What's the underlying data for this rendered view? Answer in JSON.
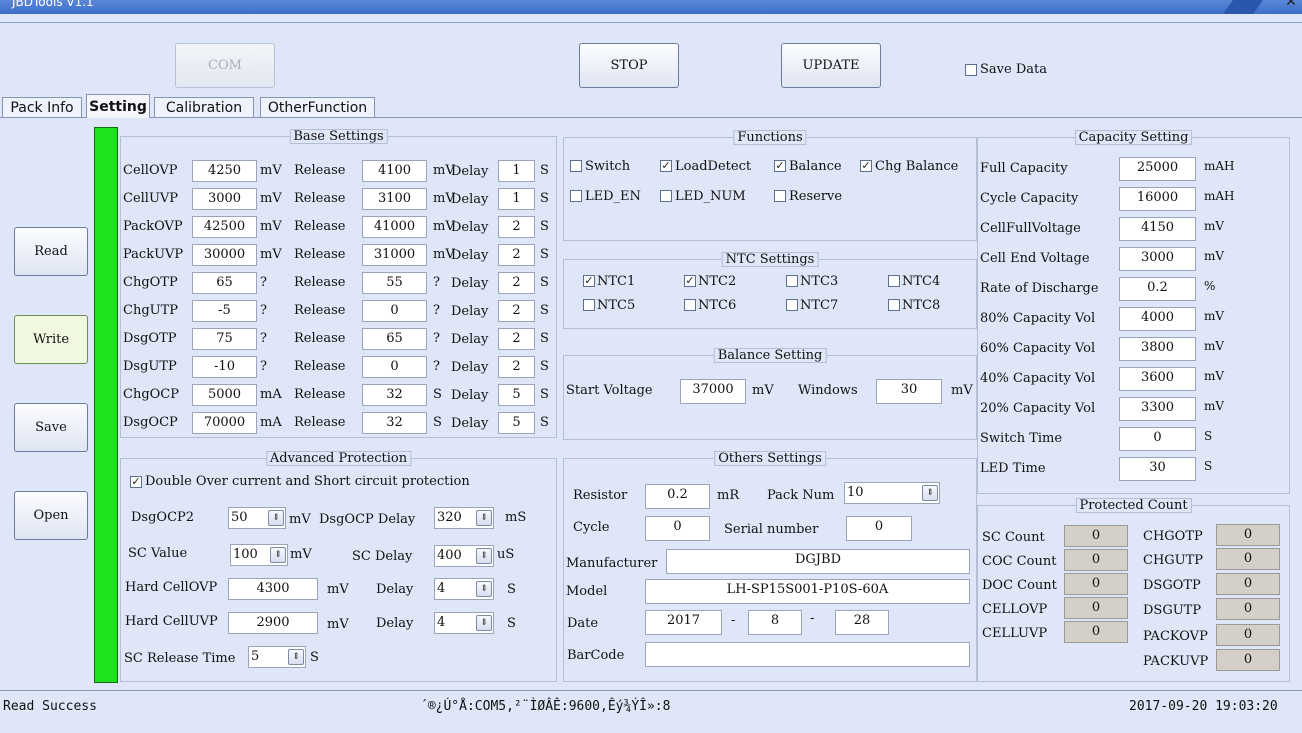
{
  "window": {
    "title": "JBDTools V1.1",
    "close": "✕"
  },
  "toolbar": {
    "com": "COM",
    "stop": "STOP",
    "update": "UPDATE",
    "save_data": "Save Data",
    "save_data_checked": false
  },
  "tabs": [
    {
      "label": "Pack Info",
      "active": false
    },
    {
      "label": "Setting",
      "active": true
    },
    {
      "label": "Calibration",
      "active": false
    },
    {
      "label": "OtherFunction",
      "active": false
    }
  ],
  "side_buttons": {
    "read": "Read",
    "write": "Write",
    "save": "Save",
    "open": "Open"
  },
  "base_settings": {
    "title": "Base Settings",
    "rows": [
      {
        "name": "CellOVP",
        "value": "4250",
        "unit": "mV",
        "rel_label": "Release",
        "release": "4100",
        "rel_unit": "mV",
        "delay_label": "Delay",
        "delay": "1",
        "delay_unit": "S"
      },
      {
        "name": "CellUVP",
        "value": "3000",
        "unit": "mV",
        "rel_label": "Release",
        "release": "3100",
        "rel_unit": "mV",
        "delay_label": "Delay",
        "delay": "1",
        "delay_unit": "S"
      },
      {
        "name": "PackOVP",
        "value": "42500",
        "unit": "mV",
        "rel_label": "Release",
        "release": "41000",
        "rel_unit": "mV",
        "delay_label": "Delay",
        "delay": "2",
        "delay_unit": "S"
      },
      {
        "name": "PackUVP",
        "value": "30000",
        "unit": "mV",
        "rel_label": "Release",
        "release": "31000",
        "rel_unit": "mV",
        "delay_label": "Delay",
        "delay": "2",
        "delay_unit": "S"
      },
      {
        "name": "ChgOTP",
        "value": "65",
        "unit": "?",
        "rel_label": "Release",
        "release": "55",
        "rel_unit": "?",
        "delay_label": "Delay",
        "delay": "2",
        "delay_unit": "S"
      },
      {
        "name": "ChgUTP",
        "value": "-5",
        "unit": "?",
        "rel_label": "Release",
        "release": "0",
        "rel_unit": "?",
        "delay_label": "Delay",
        "delay": "2",
        "delay_unit": "S"
      },
      {
        "name": "DsgOTP",
        "value": "75",
        "unit": "?",
        "rel_label": "Release",
        "release": "65",
        "rel_unit": "?",
        "delay_label": "Delay",
        "delay": "2",
        "delay_unit": "S"
      },
      {
        "name": "DsgUTP",
        "value": "-10",
        "unit": "?",
        "rel_label": "Release",
        "release": "0",
        "rel_unit": "?",
        "delay_label": "Delay",
        "delay": "2",
        "delay_unit": "S"
      },
      {
        "name": "ChgOCP",
        "value": "5000",
        "unit": "mA",
        "rel_label": "Release",
        "release": "32",
        "rel_unit": "S",
        "delay_label": "Delay",
        "delay": "5",
        "delay_unit": "S"
      },
      {
        "name": "DsgOCP",
        "value": "70000",
        "unit": "mA",
        "rel_label": "Release",
        "release": "32",
        "rel_unit": "S",
        "delay_label": "Delay",
        "delay": "5",
        "delay_unit": "S"
      }
    ]
  },
  "advanced": {
    "title": "Advanced Protection",
    "double_label": "Double Over current and Short circuit protection",
    "double_checked": true,
    "dsgocp2_label": "DsgOCP2",
    "dsgocp2_value": "50",
    "dsgocp2_unit": "mV",
    "dsgocp_delay_label": "DsgOCP Delay",
    "dsgocp_delay_value": "320",
    "dsgocp_delay_unit": "mS",
    "sc_value_label": "SC Value",
    "sc_value": "100",
    "sc_value_unit": "mV",
    "sc_delay_label": "SC Delay",
    "sc_delay_value": "400",
    "sc_delay_unit": "uS",
    "hard_ovp_label": "Hard CellOVP",
    "hard_ovp_value": "4300",
    "hard_ovp_unit": "mV",
    "hard_ovp_delay_label": "Delay",
    "hard_ovp_delay_value": "4",
    "hard_ovp_delay_unit": "S",
    "hard_uvp_label": "Hard CellUVP",
    "hard_uvp_value": "2900",
    "hard_uvp_unit": "mV",
    "hard_uvp_delay_label": "Delay",
    "hard_uvp_delay_value": "4",
    "hard_uvp_delay_unit": "S",
    "sc_release_label": "SC Release Time",
    "sc_release_value": "5",
    "sc_release_unit": "S"
  },
  "functions": {
    "title": "Functions",
    "items": [
      {
        "label": "Switch",
        "checked": false
      },
      {
        "label": "LoadDetect",
        "checked": true
      },
      {
        "label": "Balance",
        "checked": true
      },
      {
        "label": "Chg Balance",
        "checked": true
      },
      {
        "label": "LED_EN",
        "checked": false
      },
      {
        "label": "LED_NUM",
        "checked": false
      },
      {
        "label": "Reserve",
        "checked": false
      }
    ]
  },
  "ntc": {
    "title": "NTC Settings",
    "items": [
      {
        "label": "NTC1",
        "checked": true
      },
      {
        "label": "NTC2",
        "checked": true
      },
      {
        "label": "NTC3",
        "checked": false
      },
      {
        "label": "NTC4",
        "checked": false
      },
      {
        "label": "NTC5",
        "checked": false
      },
      {
        "label": "NTC6",
        "checked": false
      },
      {
        "label": "NTC7",
        "checked": false
      },
      {
        "label": "NTC8",
        "checked": false
      }
    ]
  },
  "balance": {
    "title": "Balance Setting",
    "start_label": "Start Voltage",
    "start_value": "37000",
    "start_unit": "mV",
    "windows_label": "Windows",
    "windows_value": "30",
    "windows_unit": "mV"
  },
  "others": {
    "title": "Others Settings",
    "resistor_label": "Resistor",
    "resistor_value": "0.2",
    "resistor_unit": "mR",
    "pack_num_label": "Pack Num",
    "pack_num_value": "10",
    "cycle_label": "Cycle",
    "cycle_value": "0",
    "serial_label": "Serial number",
    "serial_value": "0",
    "manufacturer_label": "Manufacturer",
    "manufacturer_value": "DGJBD",
    "model_label": "Model",
    "model_value": "LH-SP15S001-P10S-60A",
    "date_label": "Date",
    "date_year": "2017",
    "date_sep": "-",
    "date_month": "8",
    "date_day": "28",
    "barcode_label": "BarCode",
    "barcode_value": ""
  },
  "capacity": {
    "title": "Capacity Setting",
    "rows": [
      {
        "label": "Full Capacity",
        "value": "25000",
        "unit": "mAH"
      },
      {
        "label": "Cycle Capacity",
        "value": "16000",
        "unit": "mAH"
      },
      {
        "label": "CellFullVoltage",
        "value": "4150",
        "unit": "mV"
      },
      {
        "label": "Cell End Voltage",
        "value": "3000",
        "unit": "mV"
      },
      {
        "label": "Rate of Discharge",
        "value": "0.2",
        "unit": "%"
      },
      {
        "label": "80% Capacity Vol",
        "value": "4000",
        "unit": "mV"
      },
      {
        "label": "60% Capacity Vol",
        "value": "3800",
        "unit": "mV"
      },
      {
        "label": "40% Capacity Vol",
        "value": "3600",
        "unit": "mV"
      },
      {
        "label": "20% Capacity Vol",
        "value": "3300",
        "unit": "mV"
      },
      {
        "label": "Switch Time",
        "value": "0",
        "unit": "S"
      },
      {
        "label": "LED Time",
        "value": "30",
        "unit": "S"
      }
    ]
  },
  "protected": {
    "title": "Protected Count",
    "left": [
      {
        "label": "SC Count",
        "value": "0"
      },
      {
        "label": "COC Count",
        "value": "0"
      },
      {
        "label": "DOC Count",
        "value": "0"
      },
      {
        "label": "CELLOVP",
        "value": "0"
      },
      {
        "label": "CELLUVP",
        "value": "0"
      }
    ],
    "right": [
      {
        "label": "CHGOTP",
        "value": "0"
      },
      {
        "label": "CHGUTP",
        "value": "0"
      },
      {
        "label": "DSGOTP",
        "value": "0"
      },
      {
        "label": "DSGUTP",
        "value": "0"
      },
      {
        "label": "PACKOVP",
        "value": "0"
      },
      {
        "label": "PACKUVP",
        "value": "0"
      }
    ]
  },
  "status": {
    "message": "Read Success",
    "port_info": "´®¿Ú°Å:COM5,²¨ÌØÂÊ:9600,Êý¾ÝÎ»:8",
    "datetime": "2017-09-20 19:03:20"
  },
  "colors": {
    "indicator": "#1de21d",
    "background": "#dfe6f7"
  }
}
